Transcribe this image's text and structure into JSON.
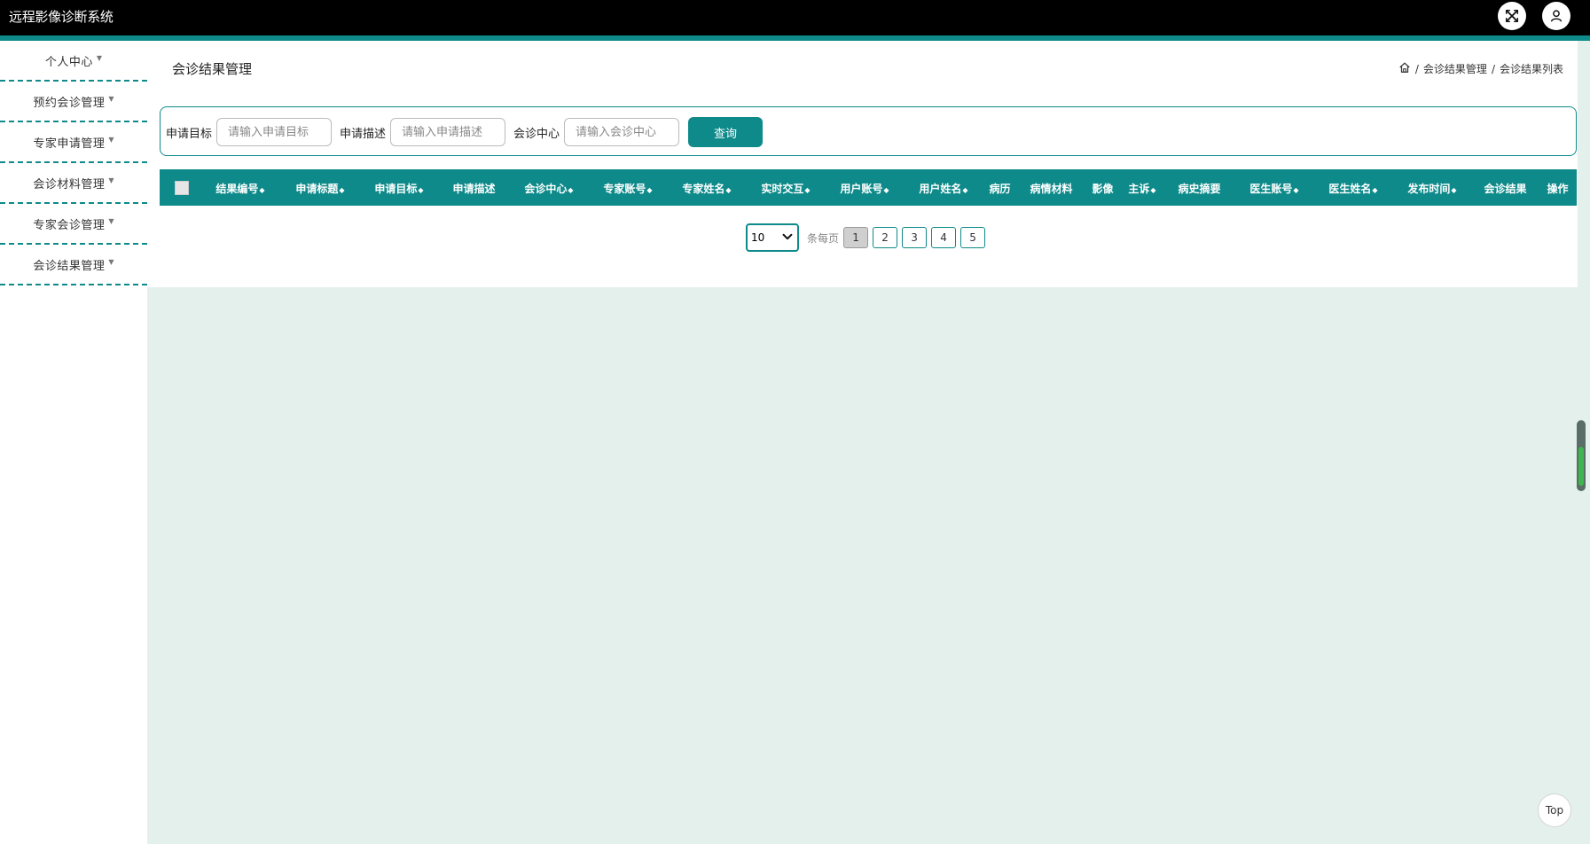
{
  "app": {
    "title": "远程影像诊断系统"
  },
  "topbar": {
    "fullscreen_icon": "fullscreen-icon",
    "user_icon": "user-icon"
  },
  "sidebar": {
    "items": [
      {
        "label": "个人中心"
      },
      {
        "label": "预约会诊管理"
      },
      {
        "label": "专家申请管理"
      },
      {
        "label": "会诊材料管理"
      },
      {
        "label": "专家会诊管理"
      },
      {
        "label": "会诊结果管理"
      }
    ]
  },
  "page": {
    "title": "会诊结果管理",
    "breadcrumb": {
      "sep": "/",
      "level1": "会诊结果管理",
      "level2": "会诊结果列表"
    }
  },
  "search": {
    "fields": [
      {
        "label": "申请目标",
        "placeholder": "请输入申请目标",
        "value": ""
      },
      {
        "label": "申请描述",
        "placeholder": "请输入申请描述",
        "value": ""
      },
      {
        "label": "会诊中心",
        "placeholder": "请输入会诊中心",
        "value": ""
      }
    ],
    "query_label": "查询"
  },
  "table": {
    "columns": [
      {
        "label": "结果编号",
        "sort": "◆"
      },
      {
        "label": "申请标题",
        "sort": "◆"
      },
      {
        "label": "申请目标",
        "sort": "◆"
      },
      {
        "label": "申请描述",
        "sort": ""
      },
      {
        "label": "会诊中心",
        "sort": "◆"
      },
      {
        "label": "专家账号",
        "sort": "◆"
      },
      {
        "label": "专家姓名",
        "sort": "◆"
      },
      {
        "label": "实时交互",
        "sort": "◆"
      },
      {
        "label": "用户账号",
        "sort": "◆"
      },
      {
        "label": "用户姓名",
        "sort": "◆"
      },
      {
        "label": "病历",
        "sort": ""
      },
      {
        "label": "病情材料",
        "sort": ""
      },
      {
        "label": "影像",
        "sort": ""
      },
      {
        "label": "主诉",
        "sort": "◆"
      },
      {
        "label": "病史摘要",
        "sort": ""
      },
      {
        "label": "医生账号",
        "sort": "◆"
      },
      {
        "label": "医生姓名",
        "sort": "◆"
      },
      {
        "label": "发布时间",
        "sort": "◆"
      },
      {
        "label": "会诊结果",
        "sort": ""
      },
      {
        "label": "操作",
        "sort": ""
      }
    ]
  },
  "pagination": {
    "page_size": "10",
    "per_page_label": "条每页",
    "pages": [
      "1",
      "2",
      "3",
      "4",
      "5"
    ],
    "current": "1"
  },
  "back_to_top": {
    "label": "Top"
  },
  "colors": {
    "accent": "#0e8a8a",
    "topbar": "#000000",
    "content_bg": "#e4f0ec"
  }
}
